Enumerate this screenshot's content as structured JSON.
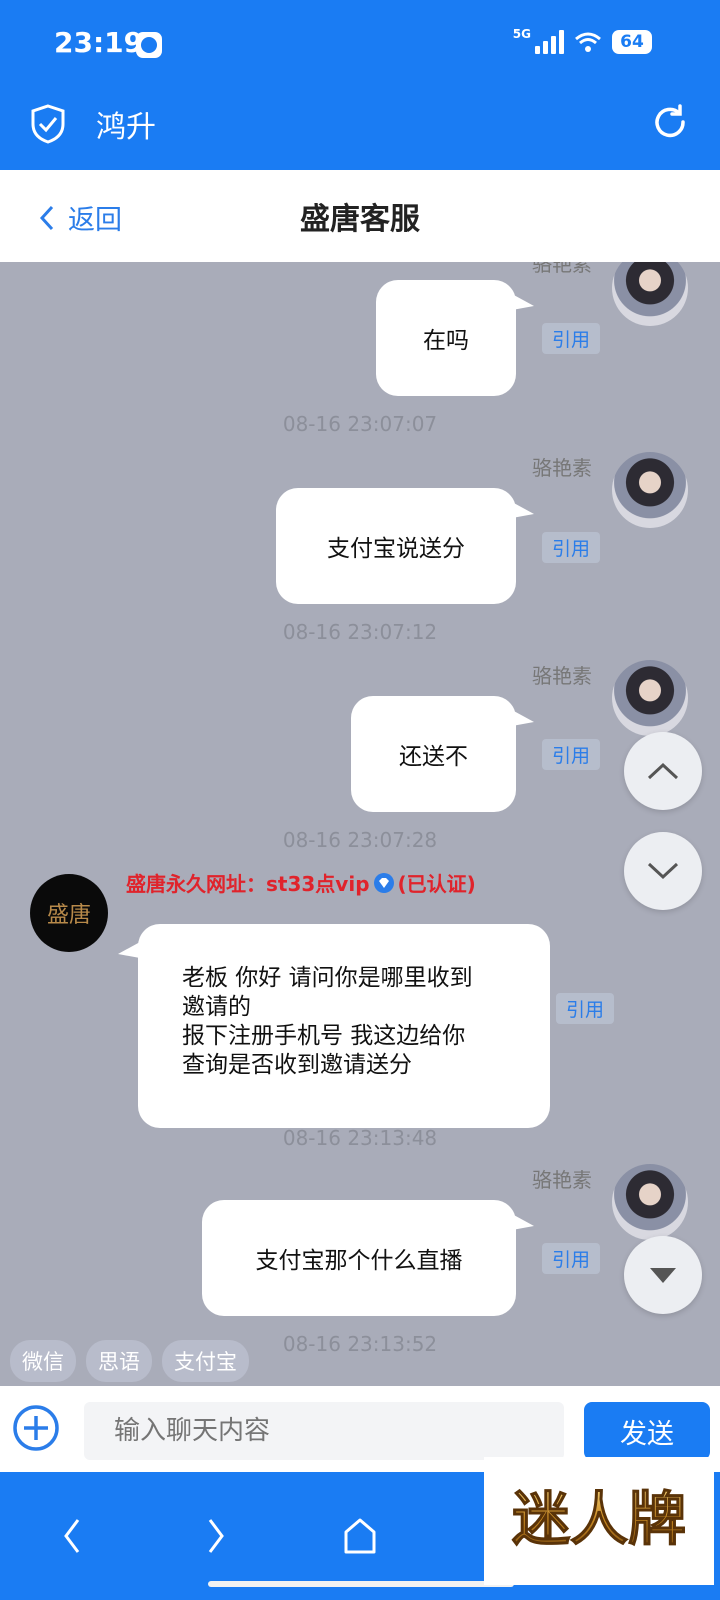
{
  "status": {
    "time": "23:19",
    "network": "5G",
    "battery": "64"
  },
  "app": {
    "title": "鸿升"
  },
  "header": {
    "back_label": "返回",
    "title": "盛唐客服"
  },
  "messages": [
    {
      "name": "",
      "text": "在吗",
      "quote": "引用",
      "time": "08-16 23:07:07"
    },
    {
      "name": "骆艳素",
      "text": "支付宝说送分",
      "quote": "引用",
      "time": "08-16 23:07:12"
    },
    {
      "name": "骆艳素",
      "text": "还送不",
      "quote": "引用",
      "time": "08-16 23:07:28"
    },
    {
      "name": "骆艳素",
      "text": "支付宝那个什么直播",
      "quote": "引用",
      "time": "08-16 23:13:52"
    }
  ],
  "cs_message": {
    "name": "盛唐永久网址：st33点vip",
    "verified": "(已认证)",
    "avatar_text": "盛唐",
    "lines": [
      "老板 你好 请问你是哪里收到",
      "邀请的",
      "报下注册手机号 我这边给你",
      "查询是否收到邀请送分"
    ],
    "quote": "引用",
    "time": "08-16 23:13:48"
  },
  "partial_name_top": "骆艳素",
  "quick_replies": [
    "微信",
    "思语",
    "支付宝"
  ],
  "input": {
    "placeholder": "输入聊天内容",
    "send_label": "发送"
  },
  "watermark_text": "迷人牌",
  "colors": {
    "brand": "#1a7cf3",
    "chat_bg": "#a9acb9",
    "cs_name": "#e0232b"
  }
}
